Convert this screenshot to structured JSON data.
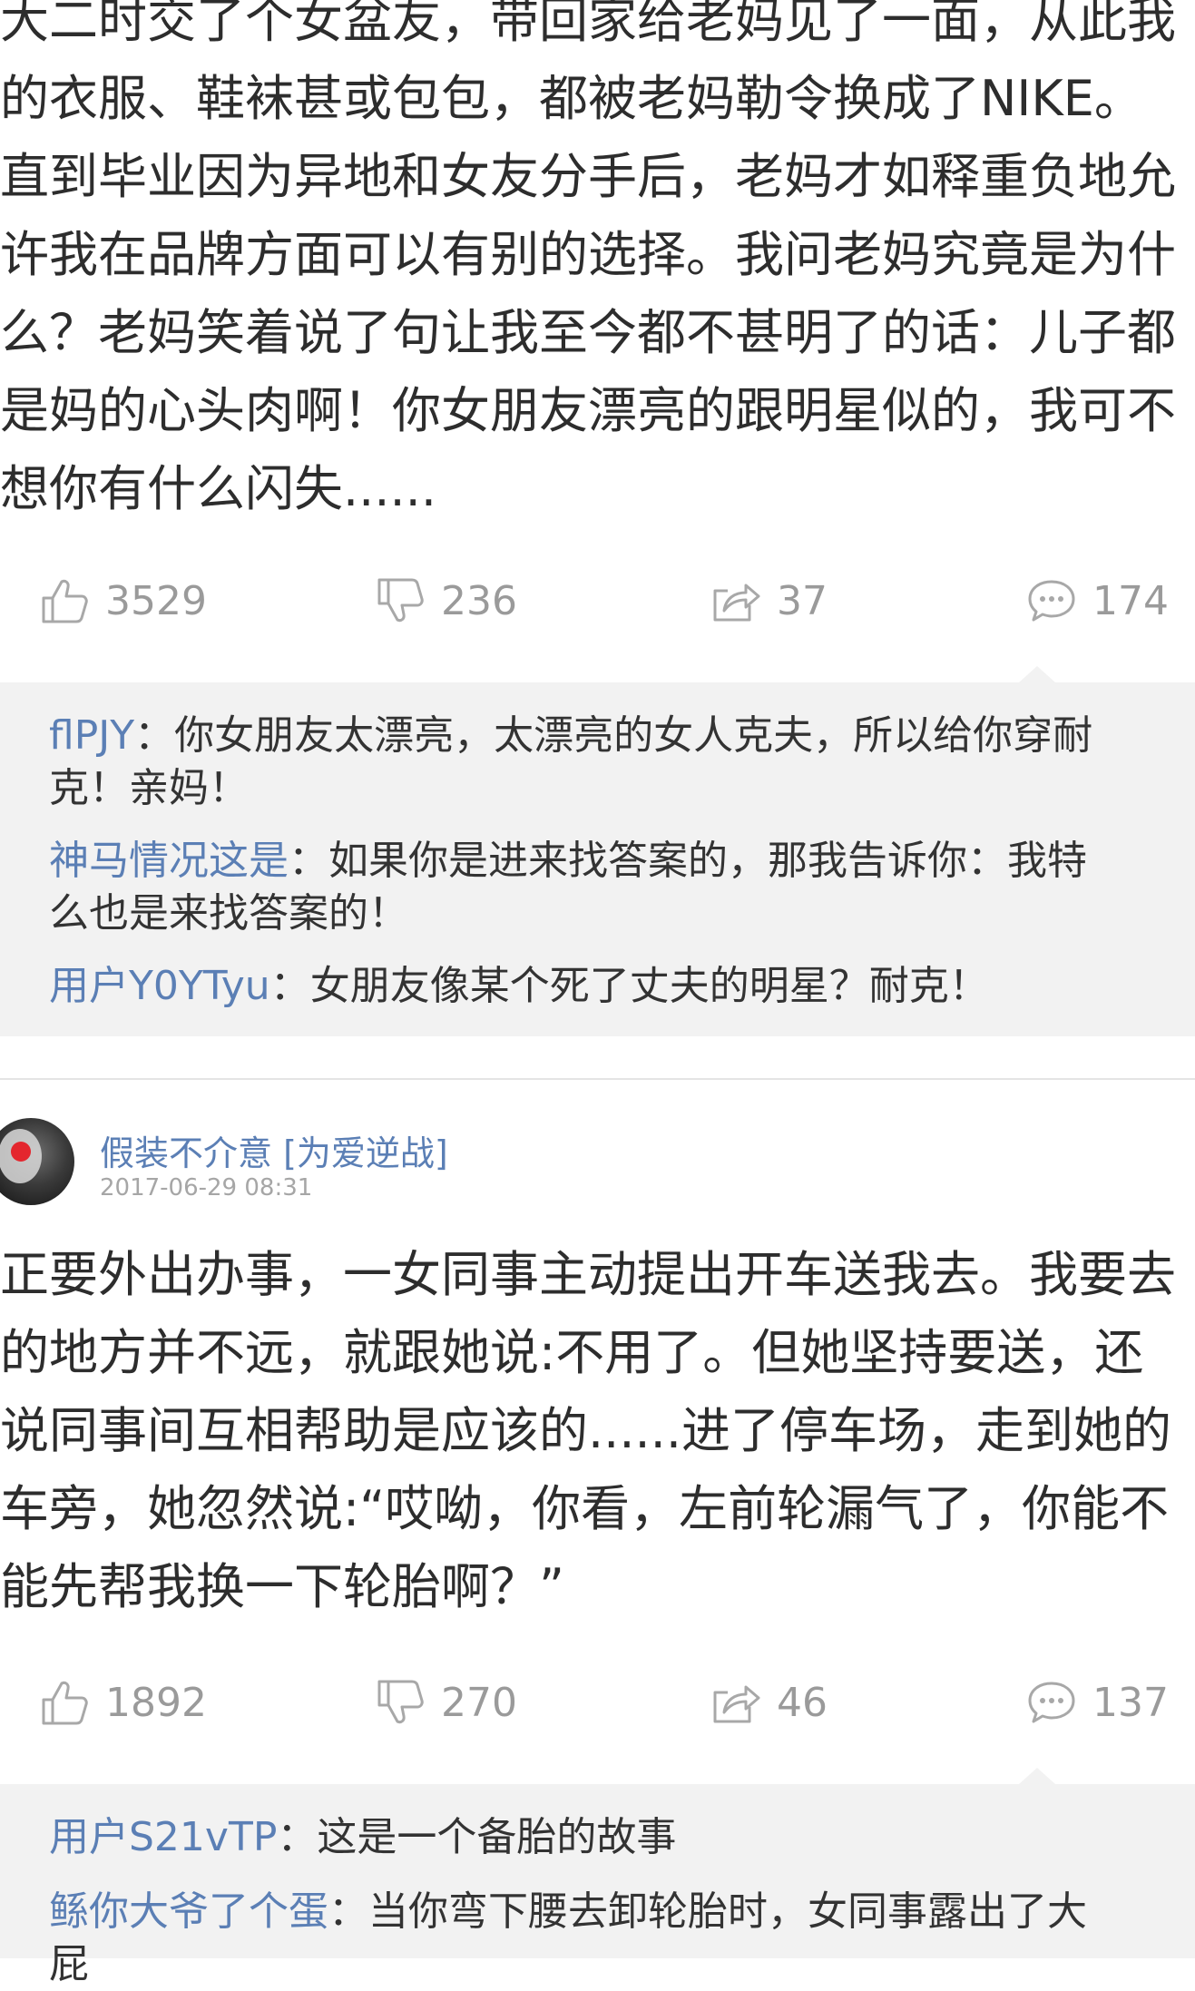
{
  "post1": {
    "lines": [
      "大二时交了个女盆友，带回家给老妈见了一面，从此我",
      "的衣服、鞋袜甚或包包，都被老妈勒令换成了NIKE。",
      "直到毕业因为异地和女友分手后，老妈才如释重负地允",
      "许我在品牌方面可以有别的选择。我问老妈究竟是为什",
      "么？老妈笑着说了句让我至今都不甚明了的话：儿子都",
      "是妈的心头肉啊！你女朋友漂亮的跟明星似的，我可不",
      "想你有什么闪失......"
    ],
    "likes": "3529",
    "dislikes": "236",
    "shares": "37",
    "comments": "174",
    "replies": [
      {
        "user": "flPJY",
        "text": "：你女朋友太漂亮，太漂亮的女人克夫，所以给你穿耐",
        "text2": "克！亲妈！"
      },
      {
        "user": "神马情况这是",
        "text": "：如果你是进来找答案的，那我告诉你：我特",
        "text2": "么也是来找答案的！"
      },
      {
        "user": "用户Y0YTyu",
        "text": "：女朋友像某个死了丈夫的明星？耐克！",
        "text2": ""
      }
    ]
  },
  "post2": {
    "author": "假装不介意 [为爱逆战]",
    "timestamp": "2017-06-29 08:31",
    "lines": [
      "正要外出办事，一女同事主动提出开车送我去。我要去",
      "的地方并不远，就跟她说:不用了。但她坚持要送，还",
      "说同事间互相帮助是应该的......进了停车场，走到她的",
      "车旁，她忽然说:“哎呦，你看，左前轮漏气了，你能不",
      "能先帮我换一下轮胎啊？”"
    ],
    "likes": "1892",
    "dislikes": "270",
    "shares": "46",
    "comments": "137",
    "replies": [
      {
        "user": "用户S21vTP",
        "text": "：这是一个备胎的故事",
        "text2": ""
      },
      {
        "user": "鲧你大爷了个蛋",
        "text": "：当你弯下腰去卸轮胎时，女同事露出了大",
        "text2": "屁"
      }
    ]
  },
  "colors": {
    "link_blue": "#5b7fb5",
    "icon_gray": "#9a9a9a",
    "comment_bg": "#f2f2f2"
  }
}
